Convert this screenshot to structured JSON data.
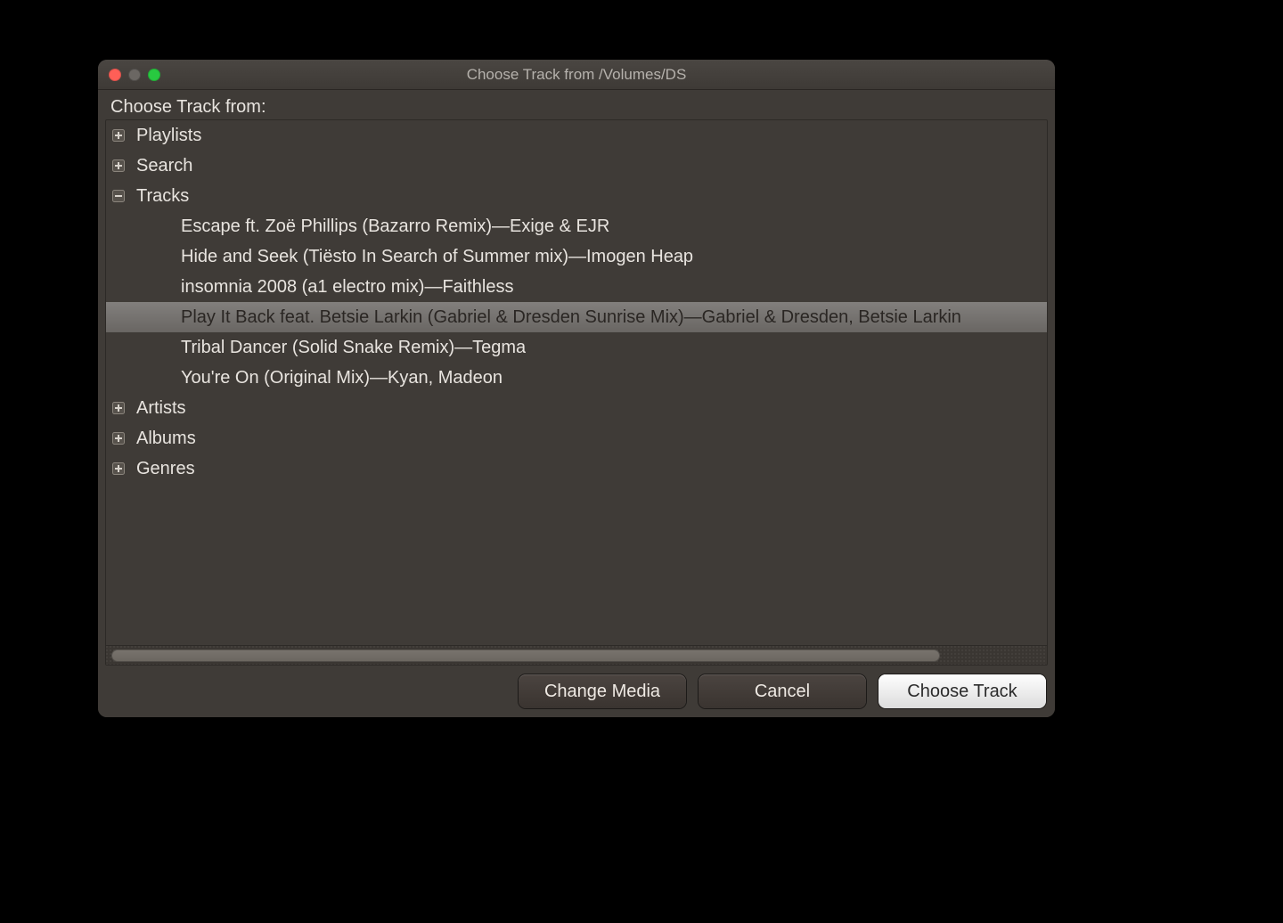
{
  "window": {
    "title": "Choose Track from /Volumes/DS"
  },
  "panel": {
    "heading": "Choose Track from:"
  },
  "tree": {
    "nodes": [
      {
        "label": "Playlists",
        "expanded": false
      },
      {
        "label": "Search",
        "expanded": false
      },
      {
        "label": "Tracks",
        "expanded": true,
        "children": [
          {
            "label": "Escape ft. Zoë Phillips (Bazarro Remix)—Exige & EJR",
            "selected": false
          },
          {
            "label": "Hide and Seek (Tiësto In Search of Summer mix)—Imogen Heap",
            "selected": false
          },
          {
            "label": "insomnia 2008 (a1 electro mix)—Faithless",
            "selected": false
          },
          {
            "label": "Play It Back feat. Betsie Larkin (Gabriel & Dresden Sunrise Mix)—Gabriel & Dresden, Betsie Larkin",
            "selected": true
          },
          {
            "label": "Tribal Dancer (Solid Snake Remix)—Tegma",
            "selected": false
          },
          {
            "label": "You're On (Original Mix)—Kyan, Madeon",
            "selected": false
          }
        ]
      },
      {
        "label": "Artists",
        "expanded": false
      },
      {
        "label": "Albums",
        "expanded": false
      },
      {
        "label": "Genres",
        "expanded": false
      }
    ]
  },
  "buttons": {
    "change_media": "Change Media",
    "cancel": "Cancel",
    "choose_track": "Choose Track"
  }
}
